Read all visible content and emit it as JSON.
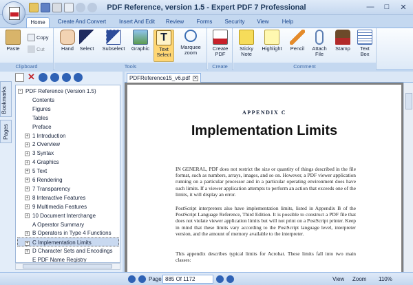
{
  "window": {
    "title": "PDF Reference, version 1.5 - Expert PDF 7 Professional",
    "controls": [
      "minimize-icon",
      "maximize-icon",
      "close-icon"
    ]
  },
  "ribbon_tabs": [
    "Home",
    "Create And Convert",
    "Insert And Edit",
    "Review",
    "Forms",
    "Security",
    "View",
    "Help"
  ],
  "ribbon": {
    "clipboard": {
      "label": "Clipboard",
      "paste": "Paste",
      "copy": "Copy",
      "cut": "Cut"
    },
    "tools": {
      "label": "Tools",
      "hand": "Hand",
      "select": "Select",
      "subselect": "Subselect",
      "graphic": "Graphic",
      "text_select_1": "Text",
      "text_select_2": "Select",
      "marquee_zoom_1": "Marquee",
      "marquee_zoom_2": "zoom"
    },
    "create": {
      "label": "Create",
      "create_pdf_1": "Create",
      "create_pdf_2": "PDF"
    },
    "comment": {
      "label": "Comment",
      "sticky_note_1": "Sticky",
      "sticky_note_2": "Note",
      "highlight": "Highlight",
      "pencil": "Pencil",
      "attach_file_1": "Attach",
      "attach_file_2": "File",
      "stamp": "Stamp",
      "text_box_1": "Text",
      "text_box_2": "Box"
    }
  },
  "side_tabs": [
    "Bookmarks",
    "Pages"
  ],
  "bookmarks": [
    {
      "label": "PDF Reference (Version 1.5)",
      "expander": "-",
      "level": 0
    },
    {
      "label": "Contents",
      "expander": "",
      "level": 1
    },
    {
      "label": "Figures",
      "expander": "",
      "level": 1
    },
    {
      "label": "Tables",
      "expander": "",
      "level": 1
    },
    {
      "label": "Preface",
      "expander": "",
      "level": 1
    },
    {
      "label": "1 Introduction",
      "expander": "+",
      "level": 1
    },
    {
      "label": "2 Overview",
      "expander": "+",
      "level": 1
    },
    {
      "label": "3 Syntax",
      "expander": "+",
      "level": 1
    },
    {
      "label": "4 Graphics",
      "expander": "+",
      "level": 1
    },
    {
      "label": "5 Text",
      "expander": "+",
      "level": 1
    },
    {
      "label": "6 Rendering",
      "expander": "+",
      "level": 1
    },
    {
      "label": "7 Transparency",
      "expander": "+",
      "level": 1
    },
    {
      "label": "8 Interactive Features",
      "expander": "+",
      "level": 1
    },
    {
      "label": "9 Multimedia Features",
      "expander": "+",
      "level": 1
    },
    {
      "label": "10 Document Interchange",
      "expander": "+",
      "level": 1
    },
    {
      "label": "A Operator Summary",
      "expander": "",
      "level": 1
    },
    {
      "label": "B Operators in Type 4 Functions",
      "expander": "+",
      "level": 1
    },
    {
      "label": "C Implementation Limits",
      "expander": "+",
      "level": 1,
      "selected": true
    },
    {
      "label": "D Character Sets and Encodings",
      "expander": "+",
      "level": 1
    },
    {
      "label": "E PDF Name Registry",
      "expander": "",
      "level": 1
    }
  ],
  "document_tab": "PDFReference15_v6.pdf",
  "page_content": {
    "appendix": "APPENDIX C",
    "heading": "Implementation Limits",
    "paragraphs": [
      "IN GENERAL, PDF does not restrict the size or quantity of things described in the file format, such as numbers, arrays, images, and so on. However, a PDF viewer application running on a particular processor and in a particular operating environment does have such limits. If a viewer application attempts to perform an action that exceeds one of the limits, it will display an error.",
      "PostScript interpreters also have implementation limits, listed in Appendix B of the PostScript Language Reference, Third Edition. It is possible to construct a PDF file that does not violate viewer application limits but will not print on a PostScript printer. Keep in mind that these limits vary according to the PostScript language level, interpreter version, and the amount of memory available to the interpreter.",
      "This appendix describes typical limits for Acrobat. These limits fall into two main classes:"
    ]
  },
  "statusbar": {
    "page_label": "Page",
    "page_value": "885 Of 1172",
    "view": "View",
    "zoom": "Zoom",
    "zoom_value": "110%"
  },
  "colors": {
    "accent": "#ffd673",
    "selection": "#c9d9f0",
    "ribbon_bg": "#dde9f7"
  }
}
